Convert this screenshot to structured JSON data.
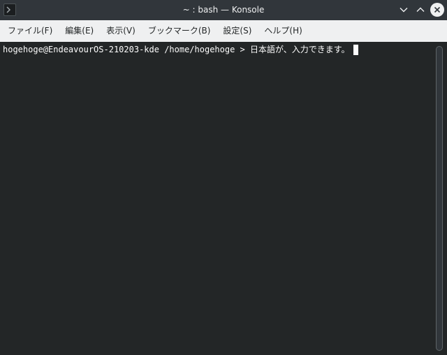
{
  "window": {
    "title": "~ : bash — Konsole"
  },
  "titlebar": {
    "app_icon": "terminal-icon",
    "buttons": {
      "minimize_icon": "chevron-down-icon",
      "maximize_icon": "chevron-up-icon",
      "close_icon": "close-icon"
    }
  },
  "menubar": {
    "items": [
      {
        "label": "ファイル(F)"
      },
      {
        "label": "編集(E)"
      },
      {
        "label": "表示(V)"
      },
      {
        "label": "ブックマーク(B)"
      },
      {
        "label": "設定(S)"
      },
      {
        "label": "ヘルプ(H)"
      }
    ]
  },
  "terminal": {
    "prompt": "hogehoge@EndeavourOS-210203-kde /home/hogehoge > ",
    "input": "日本語が、入力できます。"
  },
  "colors": {
    "titlebar_bg": "#31363b",
    "menubar_bg": "#eff0f1",
    "terminal_bg": "#232627",
    "terminal_fg": "#fcfcfc"
  }
}
